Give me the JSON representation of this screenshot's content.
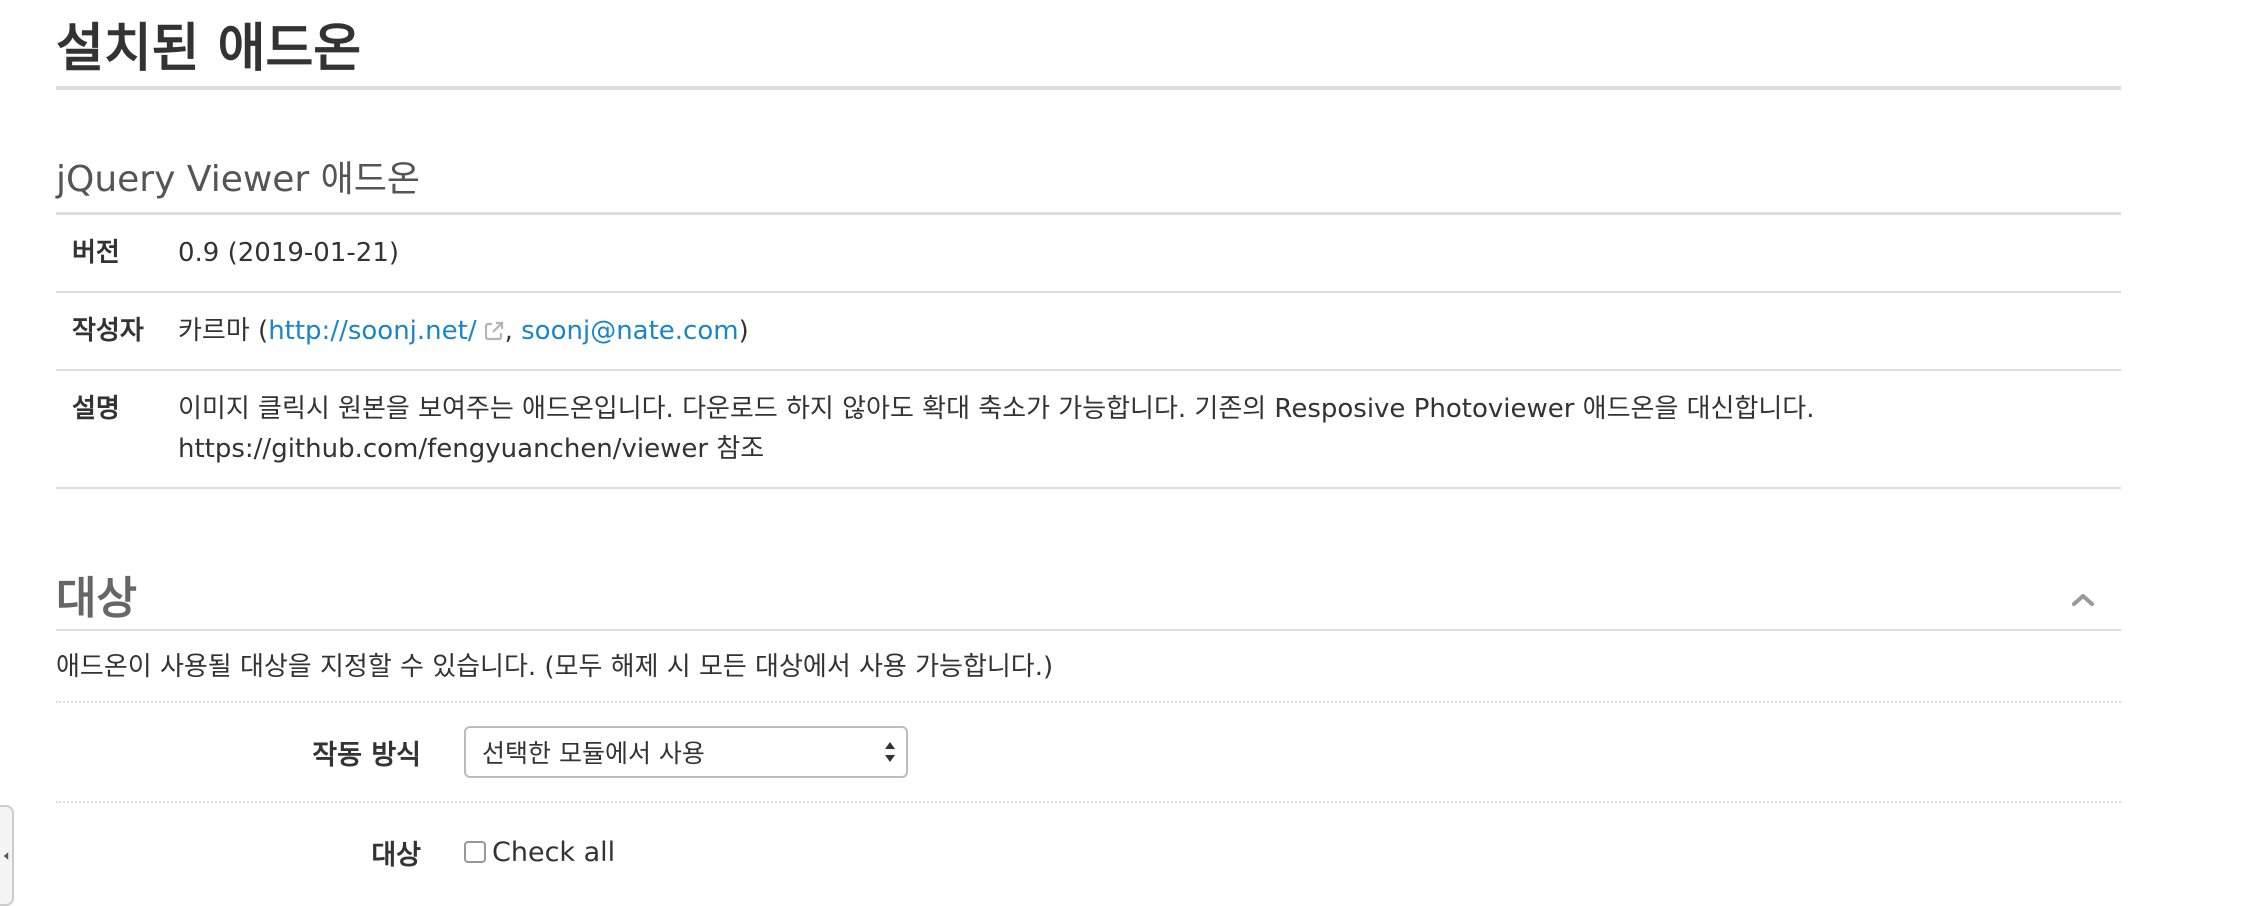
{
  "page": {
    "title": "설치된 애드온"
  },
  "addon": {
    "title": "jQuery Viewer 애드온",
    "rows": {
      "version_label": "버전",
      "version_value": "0.9 (2019-01-21)",
      "author_label": "작성자",
      "author_name": "카르마",
      "author_open": " (",
      "author_url": "http://soonj.net/",
      "author_sep": ", ",
      "author_email": "soonj@nate.com",
      "author_close": ")",
      "desc_label": "설명",
      "desc_line1": "이미지 클릭시 원본을 보여주는 애드온입니다. 다운로드 하지 않아도 확대 축소가 가능합니다. 기존의 Resposive Photoviewer 애드온을 대신합니다.",
      "desc_line2": "https://github.com/fengyuanchen/viewer 참조"
    }
  },
  "target_section": {
    "title": "대상",
    "description": "애드온이 사용될 대상을 지정할 수 있습니다. (모두 해제 시 모든 대상에서 사용 가능합니다.)",
    "mode_label": "작동 방식",
    "mode_selected": "선택한 모듈에서 사용",
    "target_label": "대상",
    "check_all_label": "Check all"
  },
  "icons": {
    "external_link": "external-link-icon",
    "collapse": "chevron-up-icon",
    "select_arrows": "up-down-arrows-icon",
    "side_tab": "caret-left-icon"
  },
  "colors": {
    "link": "#1a86c8",
    "divider": "#dddddd",
    "text": "#333333"
  }
}
